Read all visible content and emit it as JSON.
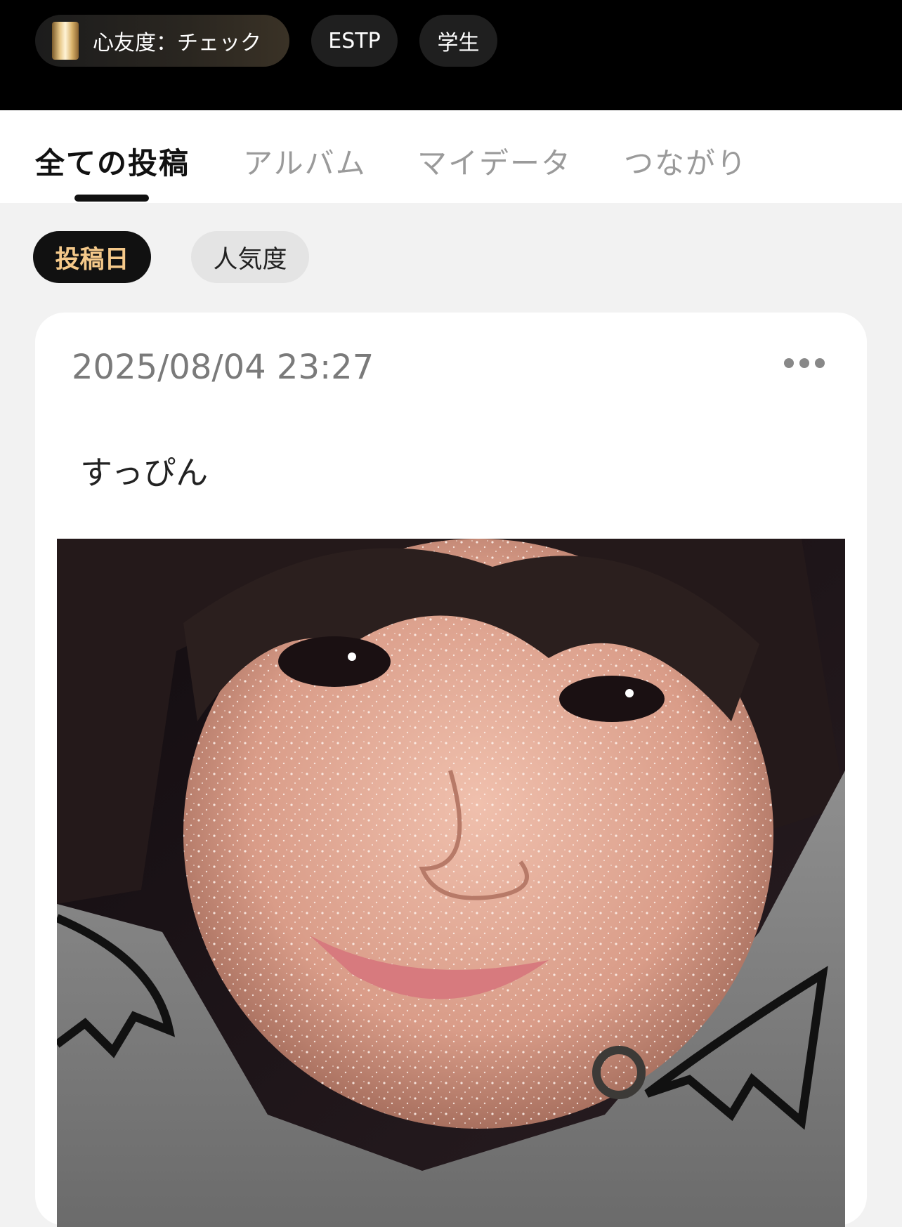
{
  "header": {
    "chips": [
      {
        "label": "心友度：チェック"
      },
      {
        "label": "ESTP"
      },
      {
        "label": "学生"
      }
    ]
  },
  "tabs": [
    {
      "label": "全ての投稿",
      "active": true
    },
    {
      "label": "アルバム",
      "active": false
    },
    {
      "label": "マイデータ",
      "active": false
    },
    {
      "label": "つながり",
      "active": false
    }
  ],
  "sort": {
    "options": [
      {
        "label": "投稿日",
        "active": true
      },
      {
        "label": "人気度",
        "active": false
      }
    ]
  },
  "post": {
    "timestamp": "2025/08/04 23:27",
    "text": "すっぴん"
  },
  "colors": {
    "accent": "#f5c98a",
    "active_tab": "#111111",
    "inactive_tab": "#9a9a9a",
    "background": "#f2f2f2"
  }
}
